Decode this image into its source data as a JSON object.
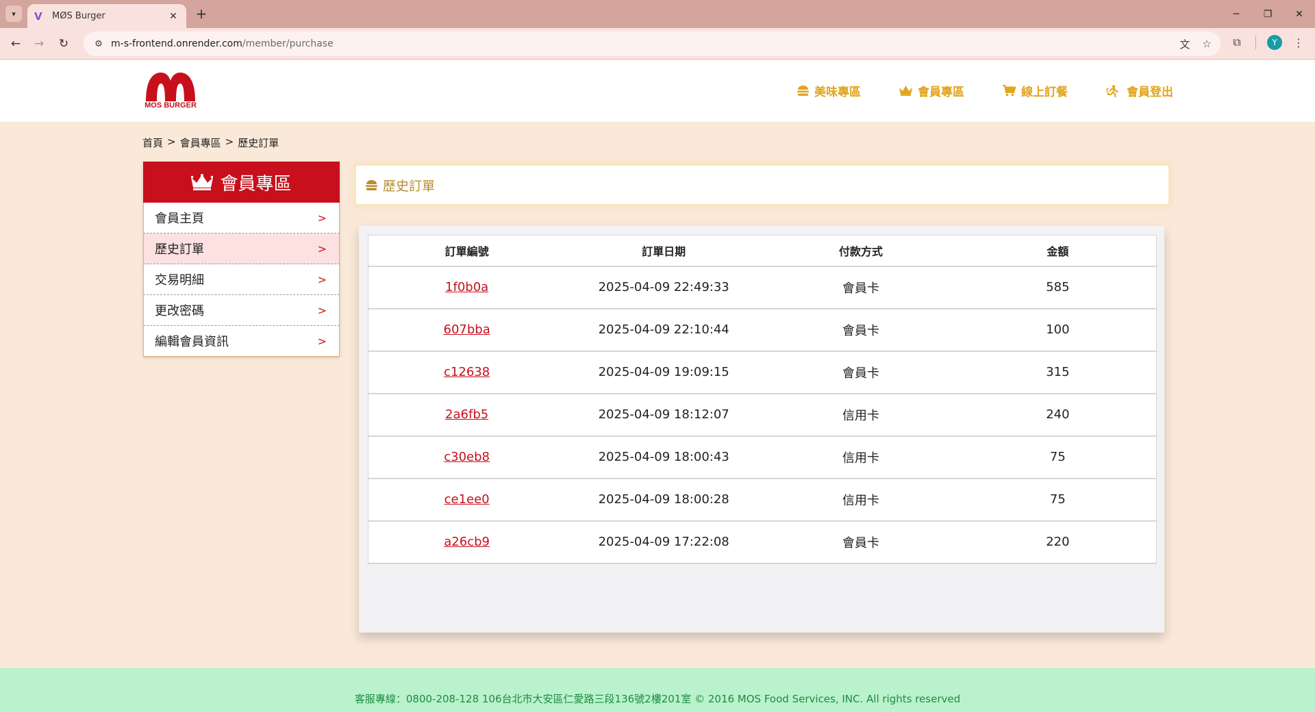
{
  "browser": {
    "tab_title": "MØS Burger",
    "url_host": "m-s-frontend.onrender.com",
    "url_path": "/member/purchase",
    "profile_initial": "Y"
  },
  "header": {
    "logo_text": "MOS BURGER",
    "nav": [
      {
        "label": "美味專區"
      },
      {
        "label": "會員專區"
      },
      {
        "label": "線上訂餐"
      },
      {
        "label": "會員登出"
      }
    ]
  },
  "breadcrumb": [
    "首頁",
    ">",
    "會員專區",
    ">",
    "歷史訂單"
  ],
  "sidebar": {
    "title": "會員專區",
    "items": [
      {
        "label": "會員主頁",
        "arrow": ">"
      },
      {
        "label": "歷史訂單",
        "arrow": ">"
      },
      {
        "label": "交易明細",
        "arrow": ">"
      },
      {
        "label": "更改密碼",
        "arrow": ">"
      },
      {
        "label": "編輯會員資訊",
        "arrow": ">"
      }
    ]
  },
  "panel": {
    "title": "歷史訂單"
  },
  "orders": {
    "columns": [
      "訂單編號",
      "訂單日期",
      "付款方式",
      "金額"
    ],
    "rows": [
      {
        "id": "1f0b0a",
        "date": "2025-04-09 22:49:33",
        "payment": "會員卡",
        "amount": "585"
      },
      {
        "id": "607bba",
        "date": "2025-04-09 22:10:44",
        "payment": "會員卡",
        "amount": "100"
      },
      {
        "id": "c12638",
        "date": "2025-04-09 19:09:15",
        "payment": "會員卡",
        "amount": "315"
      },
      {
        "id": "2a6fb5",
        "date": "2025-04-09 18:12:07",
        "payment": "信用卡",
        "amount": "240"
      },
      {
        "id": "c30eb8",
        "date": "2025-04-09 18:00:43",
        "payment": "信用卡",
        "amount": "75"
      },
      {
        "id": "ce1ee0",
        "date": "2025-04-09 18:00:28",
        "payment": "信用卡",
        "amount": "75"
      },
      {
        "id": "a26cb9",
        "date": "2025-04-09 17:22:08",
        "payment": "會員卡",
        "amount": "220"
      }
    ]
  },
  "footer": {
    "text": "客服專線：0800-208-128 106台北市大安區仁愛路三段136號2樓201室 © 2016 MOS Food Services, INC. All rights reserved"
  },
  "colors": {
    "brand_red": "#c7101b",
    "nav_gold": "#e2a51b",
    "page_bg": "#fae8d8",
    "footer_bg": "#b9f2cc",
    "footer_text": "#1f8a44"
  }
}
